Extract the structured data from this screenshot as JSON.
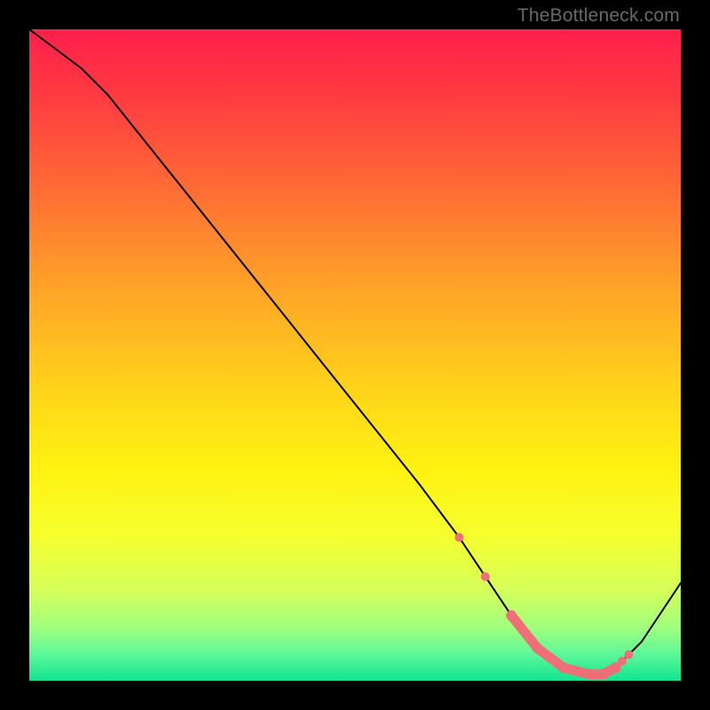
{
  "watermark": "TheBottleneck.com",
  "gradient_stops": [
    {
      "pct": 0,
      "color": "#ff1f4b"
    },
    {
      "pct": 10,
      "color": "#ff3a41"
    },
    {
      "pct": 24,
      "color": "#ff6a35"
    },
    {
      "pct": 40,
      "color": "#ffa427"
    },
    {
      "pct": 55,
      "color": "#ffd31a"
    },
    {
      "pct": 68,
      "color": "#fff312"
    },
    {
      "pct": 78,
      "color": "#f5ff2f"
    },
    {
      "pct": 86,
      "color": "#d6ff5a"
    },
    {
      "pct": 92,
      "color": "#9eff7e"
    },
    {
      "pct": 96,
      "color": "#5cf79a"
    },
    {
      "pct": 100,
      "color": "#12e38f"
    }
  ],
  "chart_data": {
    "type": "line",
    "title": "",
    "xlabel": "",
    "ylabel": "",
    "xlim": [
      0,
      100
    ],
    "ylim": [
      0,
      100
    ],
    "series": [
      {
        "name": "curve",
        "x": [
          0,
          4,
          8,
          12,
          20,
          30,
          40,
          50,
          60,
          66,
          70,
          74,
          78,
          82,
          86,
          88,
          90,
          94,
          100
        ],
        "y": [
          100,
          97,
          94,
          90,
          80,
          67.5,
          55,
          42.5,
          30,
          22,
          16,
          10,
          5,
          2,
          1,
          1,
          2,
          6,
          15
        ]
      }
    ],
    "markers": {
      "name": "sweet-spot",
      "x": [
        66,
        70,
        74,
        78,
        82,
        86,
        88,
        90,
        91,
        92
      ],
      "y": [
        22,
        16,
        10,
        5,
        2,
        1,
        1,
        2,
        3,
        4
      ],
      "band_from_index": 2,
      "band_to_index": 7
    }
  }
}
